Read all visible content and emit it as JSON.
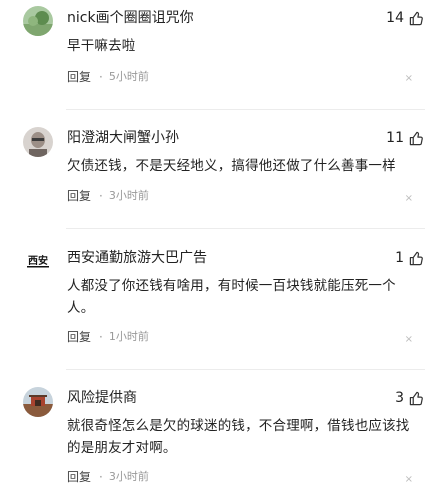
{
  "comments": [
    {
      "username": "nick画个圈圈诅咒你",
      "likes": "14",
      "content": "早干嘛去啦",
      "reply_label": "回复",
      "dot": "·",
      "time": "5小时前",
      "close": "×"
    },
    {
      "username": "阳澄湖大闸蟹小孙",
      "likes": "11",
      "content": "欠债还钱，不是天经地义，搞得他还做了什么善事一样",
      "reply_label": "回复",
      "dot": "·",
      "time": "3小时前",
      "close": "×"
    },
    {
      "username": "西安通勤旅游大巴广告",
      "avatar_text": "西安",
      "likes": "1",
      "content": "人都没了你还钱有啥用，有时候一百块钱就能压死一个人。",
      "reply_label": "回复",
      "dot": "·",
      "time": "1小时前",
      "close": "×"
    },
    {
      "username": "风险提供商",
      "likes": "3",
      "content": "就很奇怪怎么是欠的球迷的钱，不合理啊，借钱也应该找的是朋友才对啊。",
      "reply_label": "回复",
      "dot": "·",
      "time": "3小时前",
      "close": "×"
    }
  ],
  "colors": {
    "text": "#222222",
    "meta": "#999999",
    "divider": "#ececec"
  },
  "icons": {
    "like": "thumbs-up-icon",
    "close": "close-icon"
  }
}
